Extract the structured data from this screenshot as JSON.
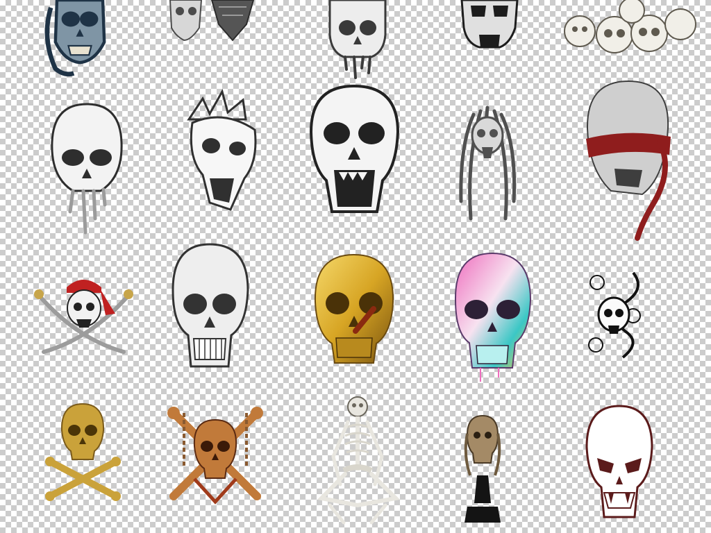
{
  "sheet": {
    "background": "transparency-checkerboard",
    "checker_light": "#ffffff",
    "checker_dark": "#cccccc"
  },
  "artworks": [
    {
      "id": "diver-mask-skull",
      "icon": "diver-mask-skull-icon",
      "fill": "#7f95a5",
      "accent": "#1f3346"
    },
    {
      "id": "bandana-twin-skulls",
      "icon": "bandana-skull-pair-icon",
      "fill": "#d7d7d7",
      "accent": "#4b4b4b"
    },
    {
      "id": "dripping-sketch-skull",
      "icon": "dripping-skull-icon",
      "fill": "#ededed",
      "accent": "#3a3a3a"
    },
    {
      "id": "stencil-skull",
      "icon": "stencil-skull-icon",
      "fill": "#e0e0e0",
      "accent": "#1d1d1d"
    },
    {
      "id": "skull-pile",
      "icon": "skull-pile-icon",
      "fill": "#f1efe8",
      "accent": "#5f5a4f"
    },
    {
      "id": "melting-skull",
      "icon": "melting-skull-icon",
      "fill": "#f3f3f3",
      "accent": "#2e2e2e"
    },
    {
      "id": "thorn-crown-skull",
      "icon": "thorn-crown-skull-icon",
      "fill": "#f7f7f7",
      "accent": "#303030"
    },
    {
      "id": "screaming-skull",
      "icon": "screaming-skull-icon",
      "fill": "#f4f4f4",
      "accent": "#222222"
    },
    {
      "id": "dreadlock-skull",
      "icon": "dreadlock-skull-icon",
      "fill": "#d9d9d9",
      "accent": "#505050"
    },
    {
      "id": "red-blindfold-skull",
      "icon": "red-blindfold-skull-icon",
      "fill": "#cfcfcf",
      "accent": "#8f1d1d"
    },
    {
      "id": "pirate-crossed-sabres",
      "icon": "pirate-skull-sabres-icon",
      "fill": "#f2f2f2",
      "accent": "#c02121"
    },
    {
      "id": "pencil-skull",
      "icon": "pencil-skull-icon",
      "fill": "#eeeeee",
      "accent": "#333333"
    },
    {
      "id": "gold-cigar-skull",
      "icon": "gold-skull-cigar-icon",
      "fill": "#d7a524",
      "accent": "#6a4a10"
    },
    {
      "id": "watercolor-skull",
      "icon": "watercolor-skull-icon",
      "fill": "#ee6dbd",
      "accent": "#3bc7c5"
    },
    {
      "id": "snake-rose-skull",
      "icon": "snake-rose-skull-icon",
      "fill": "#fbfbfb",
      "accent": "#111111"
    },
    {
      "id": "gold-jolly-roger",
      "icon": "gold-skull-crossbones-icon",
      "fill": "#caa23a",
      "accent": "#7a5a1a"
    },
    {
      "id": "bronze-chain-crossbones",
      "icon": "bronze-skull-chains-icon",
      "fill": "#c17a3a",
      "accent": "#5a2a12"
    },
    {
      "id": "seated-skeleton",
      "icon": "seated-skeleton-icon",
      "fill": "#e8e6df",
      "accent": "#6b675d"
    },
    {
      "id": "skull-bust-pedestal",
      "icon": "skull-bust-pedestal-icon",
      "fill": "#a48a66",
      "accent": "#141414"
    },
    {
      "id": "outline-vampire-skull",
      "icon": "outline-vampire-skull-icon",
      "fill": "#ffffff",
      "accent": "#5b1b1b"
    }
  ]
}
